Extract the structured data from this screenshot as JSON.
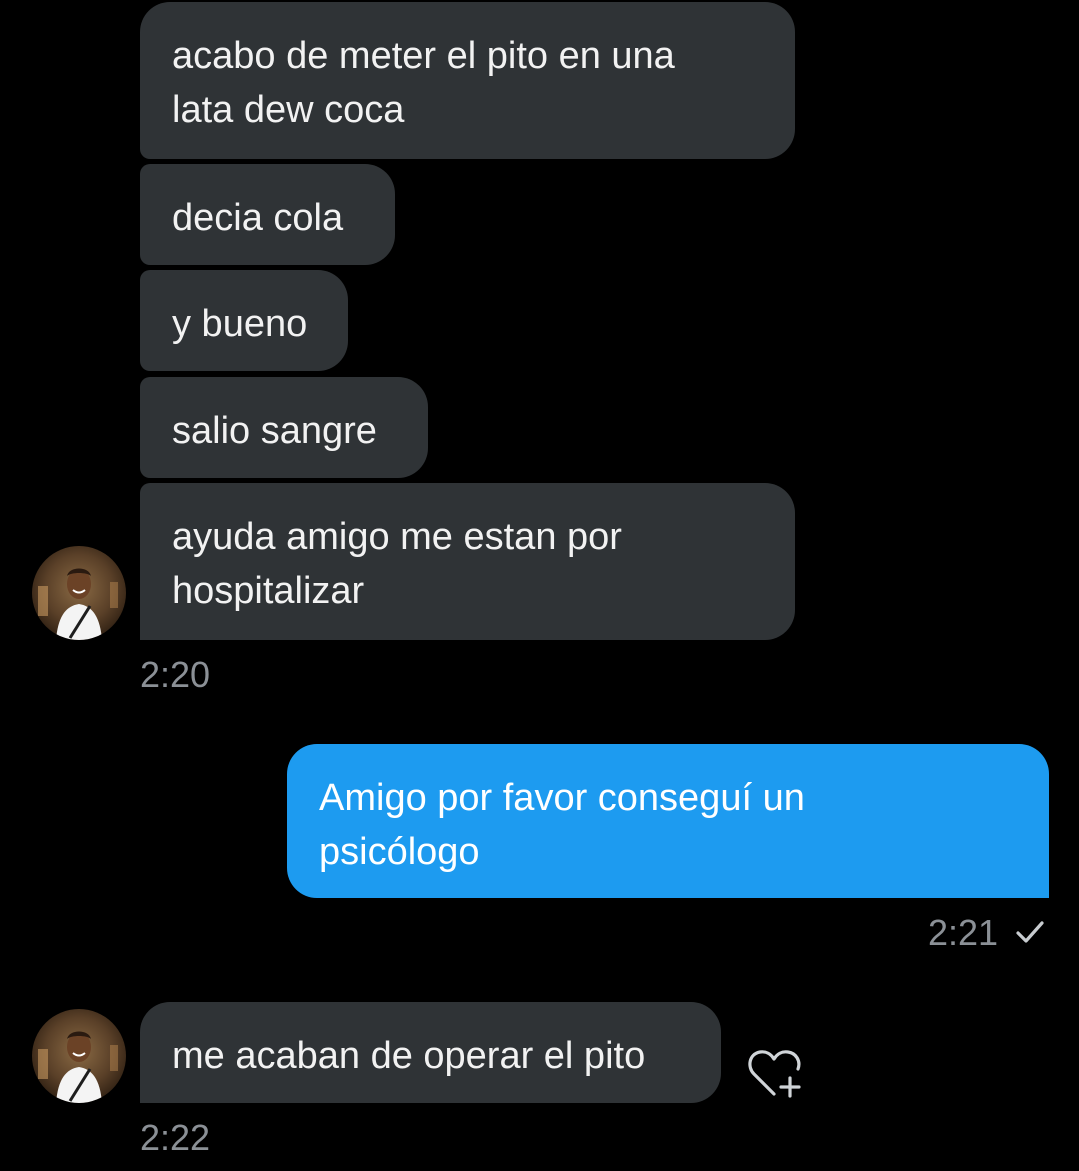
{
  "messages": [
    {
      "from": "them",
      "text_line1": "acabo de meter el pito en una",
      "text_line2": "lata dew coca"
    },
    {
      "from": "them",
      "text": "decia cola"
    },
    {
      "from": "them",
      "text": "y bueno"
    },
    {
      "from": "them",
      "text": "salio sangre"
    },
    {
      "from": "them",
      "text_line1": "ayuda amigo me estan por",
      "text_line2": "hospitalizar"
    },
    {
      "from": "me",
      "text_line1": "Amigo por favor conseguí un",
      "text_line2": "psicólogo"
    },
    {
      "from": "them",
      "text": "me acaban de operar el pito"
    }
  ],
  "timestamps": {
    "first_group": "2:20",
    "sent": "2:21",
    "last": "2:22"
  },
  "icons": {
    "read_receipt": "check-icon",
    "reaction": "heart-plus-icon",
    "avatar": "contact-avatar"
  },
  "colors": {
    "background": "#000000",
    "received_bubble": "#2f3336",
    "sent_bubble": "#1d9bf0",
    "timestamp": "#8b9096"
  }
}
